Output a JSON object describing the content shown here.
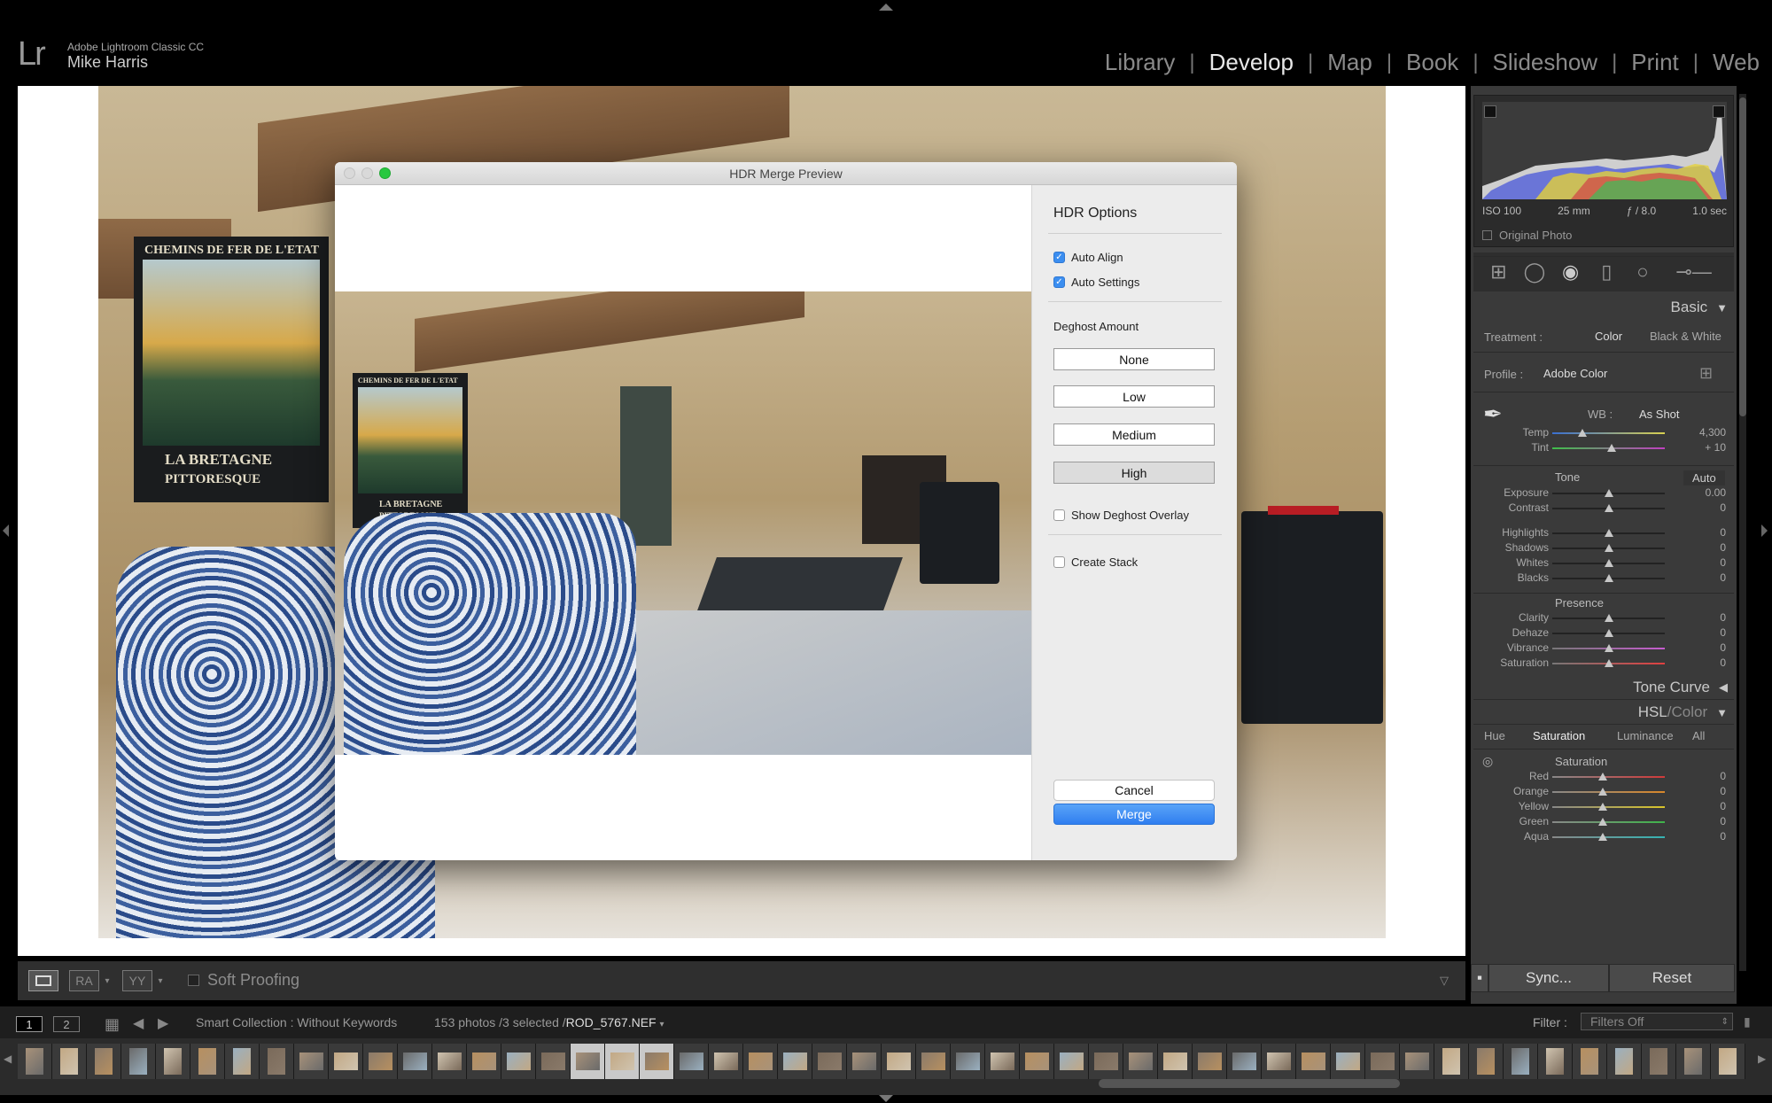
{
  "identity": {
    "logo": "Lr",
    "app_name": "Adobe Lightroom Classic CC",
    "user_name": "Mike Harris"
  },
  "modules": [
    "Library",
    "Develop",
    "Map",
    "Book",
    "Slideshow",
    "Print",
    "Web"
  ],
  "active_module": "Develop",
  "main_photo": {
    "poster_line1": "CHEMINS DE FER DE L'ETAT",
    "poster_line2": "LA BRETAGNE",
    "poster_line3": "PITTORESQUE"
  },
  "dialog": {
    "title": "HDR Merge Preview",
    "options_title": "HDR Options",
    "auto_align": {
      "label": "Auto Align",
      "checked": true
    },
    "auto_settings": {
      "label": "Auto Settings",
      "checked": true
    },
    "deghost_label": "Deghost Amount",
    "deghost_options": [
      "None",
      "Low",
      "Medium",
      "High"
    ],
    "deghost_selected": "High",
    "show_overlay": {
      "label": "Show Deghost Overlay",
      "checked": false
    },
    "create_stack": {
      "label": "Create Stack",
      "checked": false
    },
    "cancel_label": "Cancel",
    "merge_label": "Merge"
  },
  "right_panel": {
    "exif": {
      "iso": "ISO 100",
      "focal": "25 mm",
      "aperture": "ƒ / 8.0",
      "shutter": "1.0 sec"
    },
    "original_photo": "Original Photo",
    "basic_header": "Basic",
    "treatment_label": "Treatment :",
    "treatment_color": "Color",
    "treatment_bw": "Black & White",
    "profile_label": "Profile :",
    "profile_value": "Adobe Color",
    "wb_label": "WB :",
    "wb_value": "As Shot",
    "temp": {
      "label": "Temp",
      "value": "4,300"
    },
    "tint": {
      "label": "Tint",
      "value": "+ 10"
    },
    "tone_label": "Tone",
    "auto_label": "Auto",
    "tone_sliders": [
      {
        "label": "Exposure",
        "value": "0.00"
      },
      {
        "label": "Contrast",
        "value": "0"
      },
      {
        "label": "Highlights",
        "value": "0"
      },
      {
        "label": "Shadows",
        "value": "0"
      },
      {
        "label": "Whites",
        "value": "0"
      },
      {
        "label": "Blacks",
        "value": "0"
      }
    ],
    "presence_label": "Presence",
    "presence_sliders": [
      {
        "label": "Clarity",
        "value": "0"
      },
      {
        "label": "Dehaze",
        "value": "0"
      },
      {
        "label": "Vibrance",
        "value": "0"
      },
      {
        "label": "Saturation",
        "value": "0"
      }
    ],
    "tone_curve_header": "Tone Curve",
    "hsl_header_a": "HSL",
    "hsl_header_b": "Color",
    "hsl_tabs": [
      "Hue",
      "Saturation",
      "Luminance",
      "All"
    ],
    "hsl_active_tab": "Saturation",
    "saturation_label": "Saturation",
    "sat_sliders": [
      {
        "label": "Red",
        "value": "0"
      },
      {
        "label": "Orange",
        "value": "0"
      },
      {
        "label": "Yellow",
        "value": "0"
      },
      {
        "label": "Green",
        "value": "0"
      },
      {
        "label": "Aqua",
        "value": "0"
      }
    ],
    "sync_label": "Sync...",
    "reset_label": "Reset"
  },
  "toolbar": {
    "soft_proofing": "Soft Proofing",
    "ra_label": "RA",
    "yy_label": "YY"
  },
  "filmstrip": {
    "page1": "1",
    "page2": "2",
    "collection": "Smart Collection : Without Keywords",
    "count": "153 photos /3 selected /",
    "file": "ROD_5767.NEF",
    "filter_label": "Filter :",
    "filter_value": "Filters Off"
  },
  "colors": {
    "accent_blue": "#3b8ef0",
    "panel_bg": "#3a3a3a",
    "traffic_close": "#d9d9d9",
    "traffic_min": "#d9d9d9",
    "traffic_max": "#28c840"
  }
}
